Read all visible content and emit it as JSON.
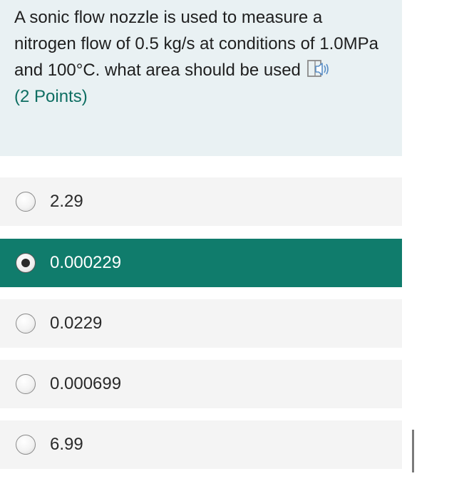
{
  "question": {
    "text": "A sonic flow nozzle is used to measure a nitrogen flow of 0.5 kg/s at conditions of 1.0MPa and 100°C. what area should be used",
    "points": "(2 Points)",
    "reader_icon": "immersive-reader-icon"
  },
  "options": [
    {
      "label": "2.29",
      "selected": false
    },
    {
      "label": "0.000229",
      "selected": true
    },
    {
      "label": "0.0229",
      "selected": false
    },
    {
      "label": "0.000699",
      "selected": false
    },
    {
      "label": "6.99",
      "selected": false
    }
  ],
  "colors": {
    "question_bg": "#e9f1f3",
    "accent": "#107c6c",
    "option_bg": "#f4f4f4"
  }
}
